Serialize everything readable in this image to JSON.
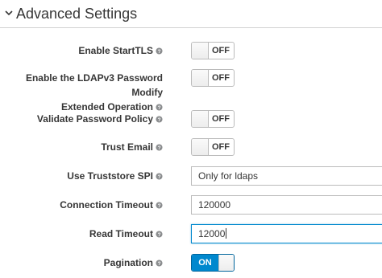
{
  "section": {
    "title": "Advanced Settings"
  },
  "settings": [
    {
      "label_lines": [
        "Enable StartTLS"
      ],
      "type": "toggle",
      "value": "OFF",
      "on": false
    },
    {
      "label_lines": [
        "Enable the LDAPv3 Password Modify",
        "Extended Operation"
      ],
      "type": "toggle",
      "value": "OFF",
      "on": false
    },
    {
      "label_lines": [
        "Validate Password Policy"
      ],
      "type": "toggle",
      "value": "OFF",
      "on": false
    },
    {
      "label_lines": [
        "Trust Email"
      ],
      "type": "toggle",
      "value": "OFF",
      "on": false
    },
    {
      "label_lines": [
        "Use Truststore SPI"
      ],
      "type": "select",
      "value": "Only for ldaps"
    },
    {
      "label_lines": [
        "Connection Timeout"
      ],
      "type": "input",
      "value": "120000"
    },
    {
      "label_lines": [
        "Read Timeout"
      ],
      "type": "input",
      "value": "12000"
    },
    {
      "label_lines": [
        "Pagination"
      ],
      "type": "toggle",
      "value": "ON",
      "on": true
    }
  ],
  "icons": {
    "help": "help-circle-icon",
    "section": "chevron-down-icon"
  },
  "colors": {
    "toggle_on": "#0088ce",
    "focus_border": "#0088ce"
  }
}
